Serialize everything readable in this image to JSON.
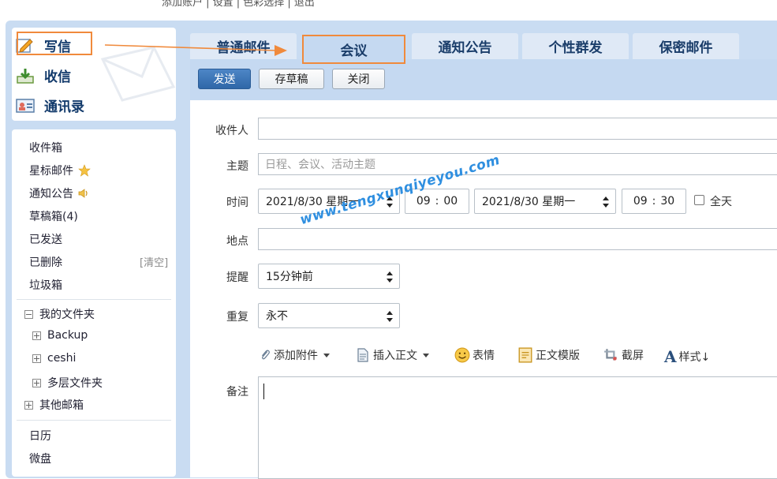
{
  "top_cut_text": "添加账户 | 设置 | 色彩选择 | 退出",
  "quick_actions": {
    "write": "写信",
    "receive": "收信",
    "contacts": "通讯录"
  },
  "nav": {
    "inbox": "收件箱",
    "starred": "星标邮件",
    "notices": "通知公告",
    "drafts": "草稿箱(4)",
    "sent": "已发送",
    "deleted": "已删除",
    "clear": "[清空]",
    "junk": "垃圾箱",
    "my_folders": "我的文件夹",
    "folders": [
      "Backup",
      "ceshi",
      "多层文件夹"
    ],
    "other_mailboxes": "其他邮箱",
    "calendar": "日历",
    "netdisk": "微盘"
  },
  "tabs": [
    "普通邮件",
    "会议",
    "通知公告",
    "个性群发",
    "保密邮件"
  ],
  "toolbar": {
    "send": "发送",
    "save_draft": "存草稿",
    "close": "关闭"
  },
  "form": {
    "recipients_label": "收件人",
    "subject_label": "主题",
    "subject_placeholder": "日程、会议、活动主题",
    "time_label": "时间",
    "start_date": "2021/8/30 星期一",
    "start_hour": "09",
    "start_min": "00",
    "end_date": "2021/8/30 星期一",
    "end_hour": "09",
    "end_min": "30",
    "all_day": "全天",
    "location_label": "地点",
    "reminder_label": "提醒",
    "reminder_value": "15分钟前",
    "repeat_label": "重复",
    "repeat_value": "永不",
    "notes_label": "备注"
  },
  "editor_tools": {
    "attach": "添加附件",
    "insert_body": "插入正文",
    "emoji": "表情",
    "template": "正文模版",
    "screenshot": "截屏",
    "style": "样式↓"
  },
  "watermark": "www.tengxunqiyeyou.com",
  "colors": {
    "frame": "#c9dcf2",
    "highlight": "#f08a3c",
    "send": "#3a72b5",
    "watermark": "#2f8fe0"
  }
}
